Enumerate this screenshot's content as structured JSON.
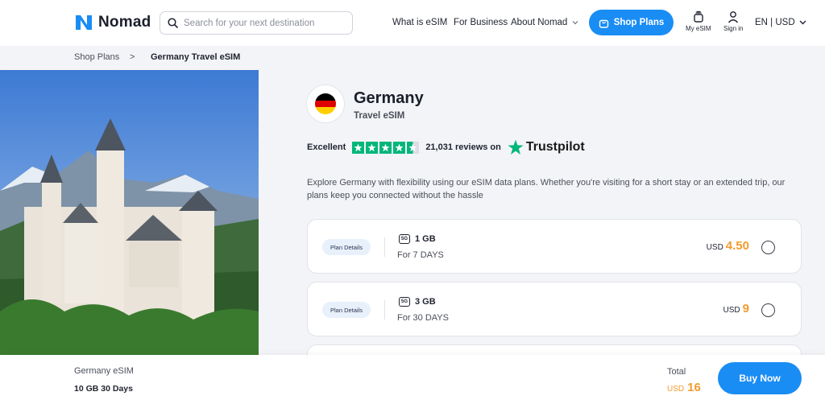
{
  "brand": {
    "name": "Nomad",
    "accent": "#1a8df5",
    "price_color": "#f39b2f"
  },
  "search": {
    "placeholder": "Search for your next destination"
  },
  "nav": {
    "what_is_esim": "What is eSIM",
    "for_business": "For Business",
    "about": "About Nomad",
    "shop_plans": "Shop Plans",
    "my_esim": "My eSIM",
    "sign_in": "Sign in",
    "lang_currency": "EN | USD"
  },
  "breadcrumb": {
    "parent": "Shop Plans",
    "separator": ">",
    "current": "Germany Travel eSIM"
  },
  "product": {
    "title": "Germany",
    "subtitle": "Travel eSIM",
    "flag_colors": [
      "#000000",
      "#dd0000",
      "#ffce00"
    ],
    "rating_label": "Excellent",
    "rating_stars": 4.5,
    "reviews": "21,031 reviews on",
    "trustpilot": "Trustpilot",
    "description": "Explore Germany with flexibility using our eSIM data plans. Whether you're visiting for a short stay or an extended trip, our plans keep you connected without the hassle"
  },
  "plans": [
    {
      "details_label": "Plan Details",
      "network": "5G",
      "data": "1 GB",
      "duration": "For 7 DAYS",
      "currency": "USD",
      "price": "4.50"
    },
    {
      "details_label": "Plan Details",
      "network": "5G",
      "data": "3 GB",
      "duration": "For 30 DAYS",
      "currency": "USD",
      "price": "9"
    }
  ],
  "summary": {
    "name": "Germany eSIM",
    "plan": "10 GB 30 Days",
    "total_label": "Total",
    "currency": "USD",
    "total": "16",
    "buy_label": "Buy Now"
  }
}
